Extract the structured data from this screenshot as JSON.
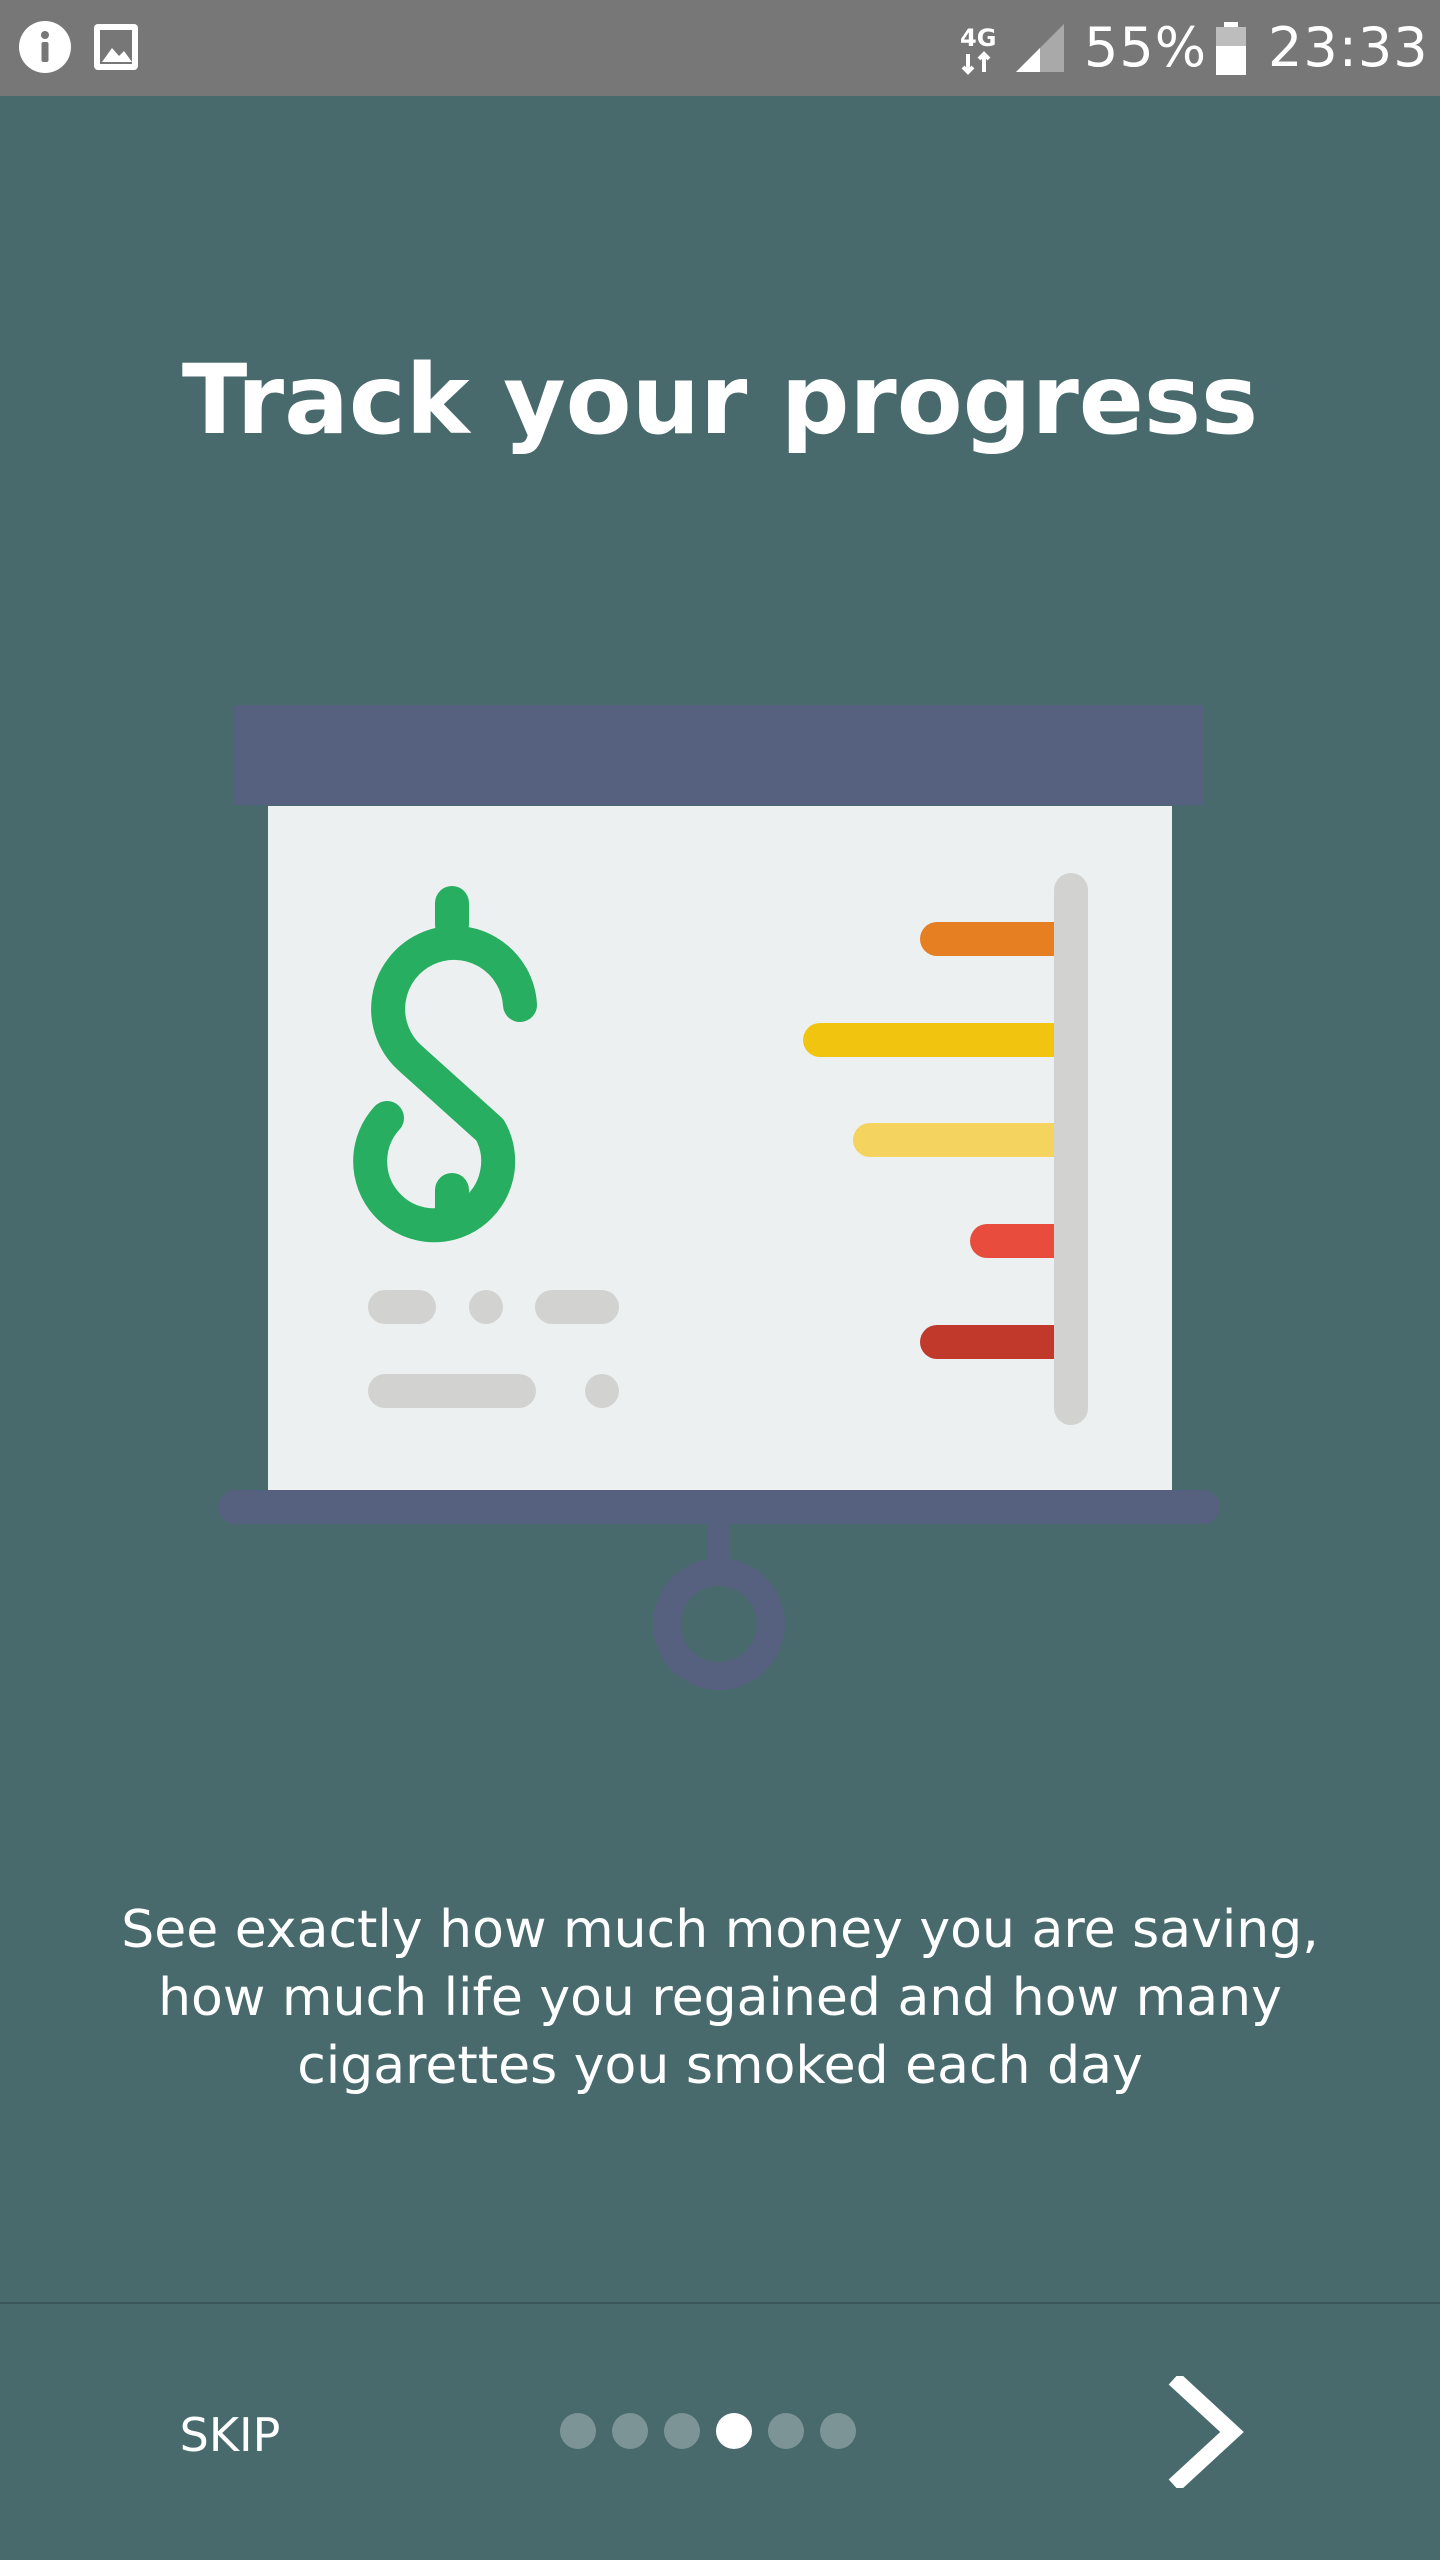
{
  "status_bar": {
    "left_icons": [
      "info-icon",
      "image-icon"
    ],
    "network_label": "4G",
    "battery_percent": "55%",
    "time": "23:33"
  },
  "onboarding": {
    "title": "Track your progress",
    "description": "See exactly how much money you are saving, how much life you regained and how many cigarettes you smoked each day",
    "skip_label": "SKIP",
    "page_count": 6,
    "current_page": 4
  },
  "illustration": {
    "icon": "presentation-board-icon",
    "currency_symbol": "$",
    "bar_colors": [
      "#e67e22",
      "#f1c40f",
      "#f4d35e",
      "#e74c3c",
      "#c0392b"
    ]
  },
  "colors": {
    "background": "#486a6c",
    "status_bar": "#777777",
    "accent_dollar": "#27ae60",
    "board_frame": "#56617f"
  }
}
